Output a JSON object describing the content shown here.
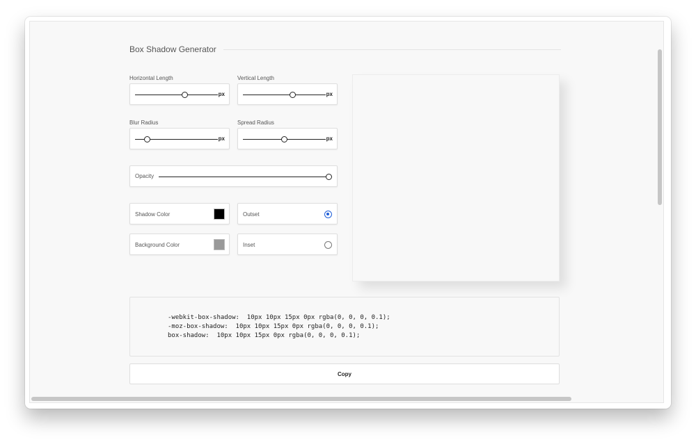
{
  "page": {
    "title": "Box Shadow Generator"
  },
  "controls": {
    "horizontal_length": {
      "label": "Horizontal Length",
      "unit": "px",
      "value_fraction": 0.6
    },
    "vertical_length": {
      "label": "Vertical Length",
      "unit": "px",
      "value_fraction": 0.6
    },
    "blur_radius": {
      "label": "Blur Radius",
      "unit": "px",
      "value_fraction": 0.15
    },
    "spread_radius": {
      "label": "Spread Radius",
      "unit": "px",
      "value_fraction": 0.5
    },
    "opacity": {
      "label": "Opacity",
      "value_fraction": 1.0
    },
    "shadow_color": {
      "label": "Shadow Color",
      "color": "#000000"
    },
    "background_color": {
      "label": "Background Color",
      "color": "#999999"
    },
    "outset": {
      "label": "Outset",
      "selected": true
    },
    "inset": {
      "label": "Inset",
      "selected": false
    }
  },
  "code": {
    "webkit": "-webkit-box-shadow:  10px 10px 15px 0px rgba(0, 0, 0, 0.1);",
    "moz": "-moz-box-shadow:  10px 10px 15px 0px rgba(0, 0, 0, 0.1);",
    "standard": "box-shadow:  10px 10px 15px 0px rgba(0, 0, 0, 0.1);"
  },
  "buttons": {
    "copy": "Copy"
  },
  "colors": {
    "accent": "#1f5ed8"
  }
}
